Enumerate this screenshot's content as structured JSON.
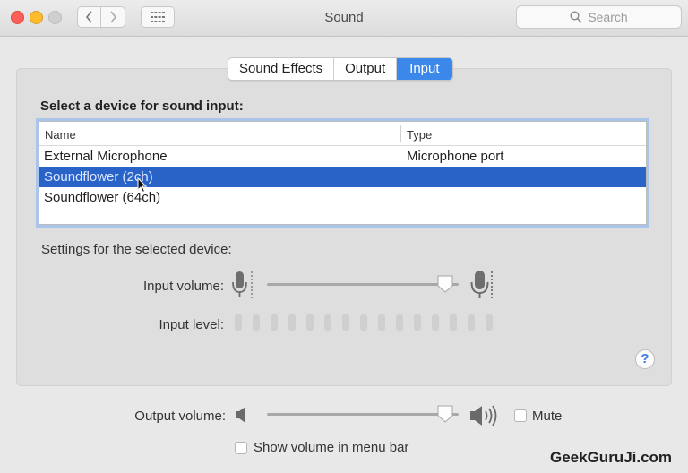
{
  "window": {
    "title": "Sound"
  },
  "search": {
    "placeholder": "Search"
  },
  "tabs": [
    {
      "label": "Sound Effects",
      "active": false
    },
    {
      "label": "Output",
      "active": false
    },
    {
      "label": "Input",
      "active": true
    }
  ],
  "input_section": {
    "title": "Select a device for sound input:",
    "columns": [
      "Name",
      "Type"
    ],
    "rows": [
      {
        "name": "External Microphone",
        "type": "Microphone port",
        "selected": false
      },
      {
        "name": "Soundflower (2ch)",
        "type": "",
        "selected": true
      },
      {
        "name": "Soundflower (64ch)",
        "type": "",
        "selected": false
      }
    ]
  },
  "settings": {
    "title": "Settings for the selected device:",
    "input_volume_label": "Input volume:",
    "input_volume_value": 0.93,
    "input_level_label": "Input level:",
    "input_level_segments": 15,
    "input_level_active": 0
  },
  "output": {
    "volume_label": "Output volume:",
    "volume_value": 0.93,
    "mute_label": "Mute",
    "mute_checked": false,
    "menu_bar_label": "Show volume in menu bar",
    "menu_bar_checked": false
  },
  "help": {
    "label": "?"
  },
  "watermark": "GeekGuruJi.com",
  "colors": {
    "accent": "#3c88ea",
    "selection": "#2a63c8"
  }
}
